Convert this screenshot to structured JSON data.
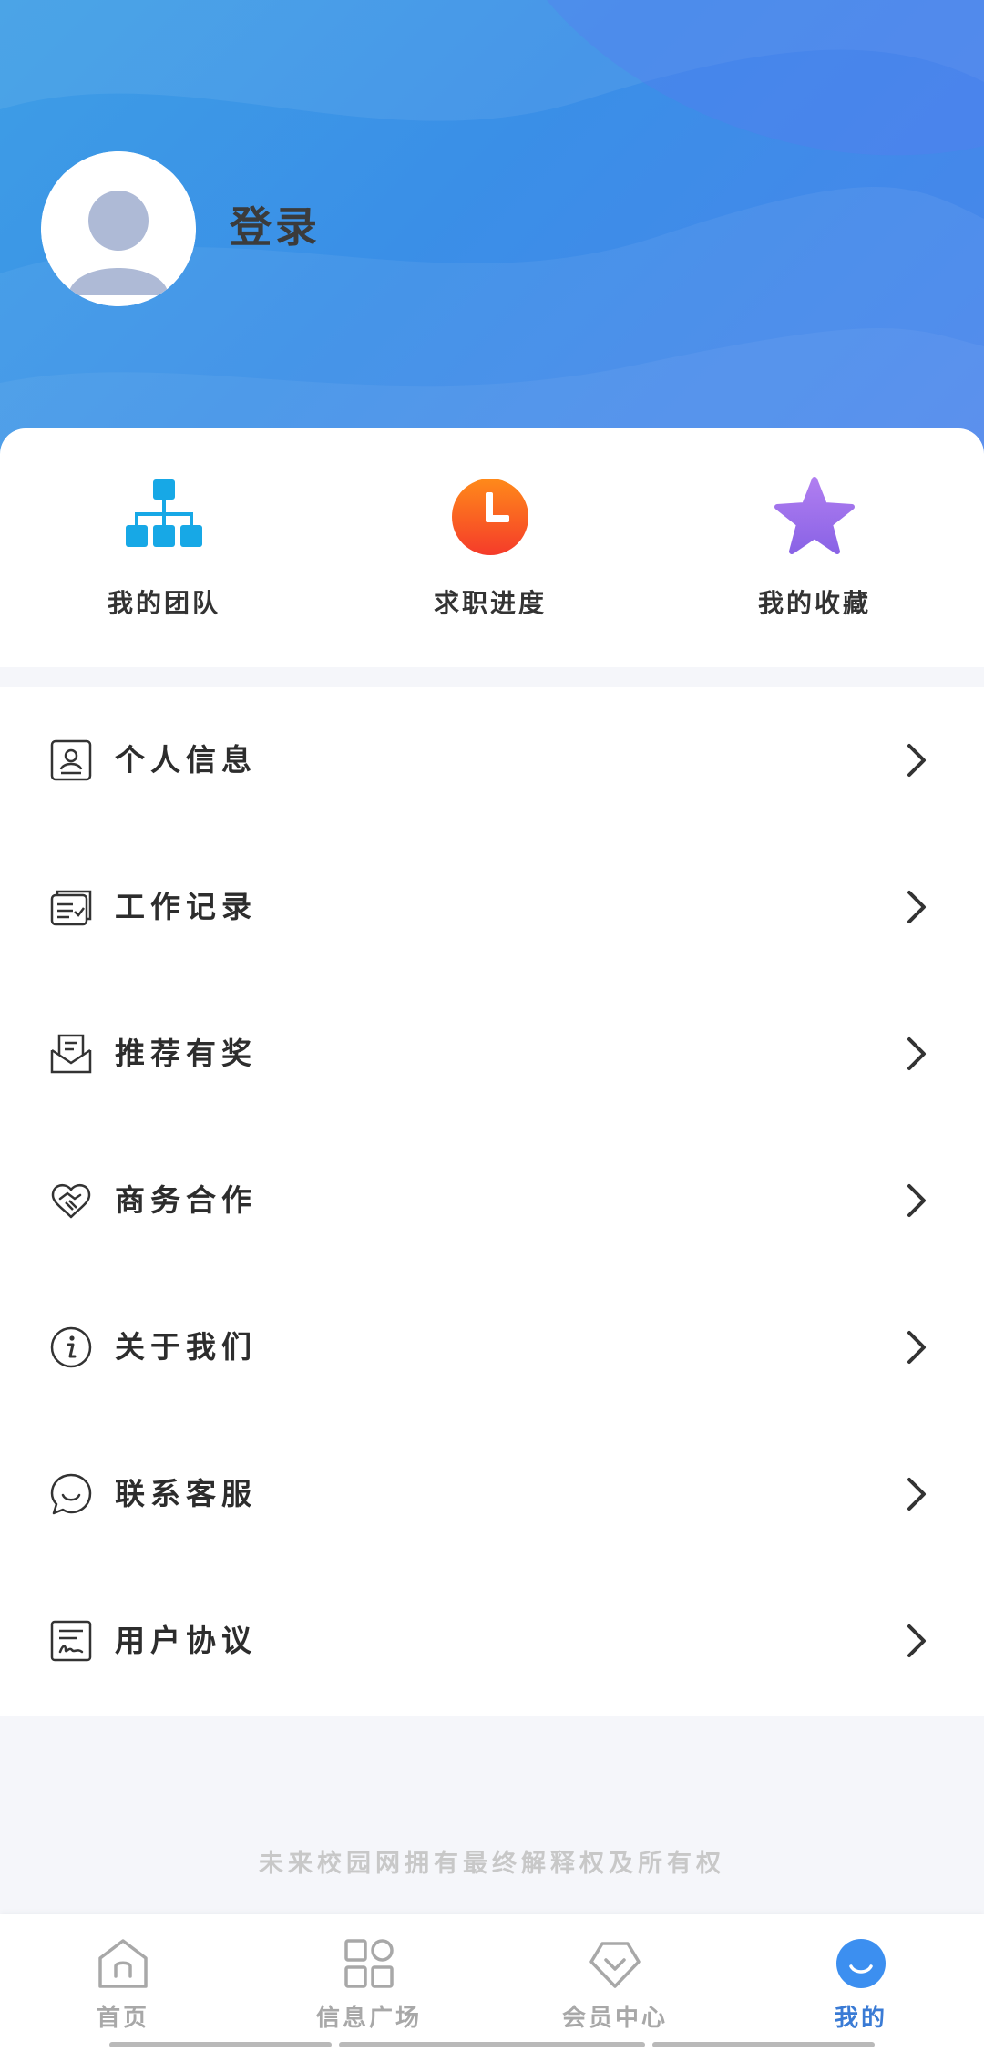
{
  "header": {
    "login_label": "登录"
  },
  "quick_actions": [
    {
      "label": "我的团队",
      "icon": "org-chart-icon",
      "color": "#17a8e6"
    },
    {
      "label": "求职进度",
      "icon": "clock-icon",
      "color": "#ff5a1f"
    },
    {
      "label": "我的收藏",
      "icon": "star-icon",
      "color": "#9a6ee8"
    }
  ],
  "menu": [
    {
      "label": "个人信息",
      "icon": "id-card-icon"
    },
    {
      "label": "工作记录",
      "icon": "records-icon"
    },
    {
      "label": "推荐有奖",
      "icon": "envelope-icon"
    },
    {
      "label": "商务合作",
      "icon": "handshake-icon"
    },
    {
      "label": "关于我们",
      "icon": "info-icon"
    },
    {
      "label": "联系客服",
      "icon": "chat-icon"
    },
    {
      "label": "用户协议",
      "icon": "agreement-icon"
    }
  ],
  "footer": {
    "copyright": "未来校园网拥有最终解释权及所有权"
  },
  "tabs": [
    {
      "label": "首页",
      "icon": "home-icon",
      "active": false
    },
    {
      "label": "信息广场",
      "icon": "grid-icon",
      "active": false
    },
    {
      "label": "会员中心",
      "icon": "diamond-icon",
      "active": false
    },
    {
      "label": "我的",
      "icon": "smile-icon",
      "active": true
    }
  ],
  "colors": {
    "accent": "#3a7bd5",
    "hero_start": "#3e9ee6",
    "hero_end": "#4a84ec",
    "inactive_tab": "#a8a8a8"
  }
}
